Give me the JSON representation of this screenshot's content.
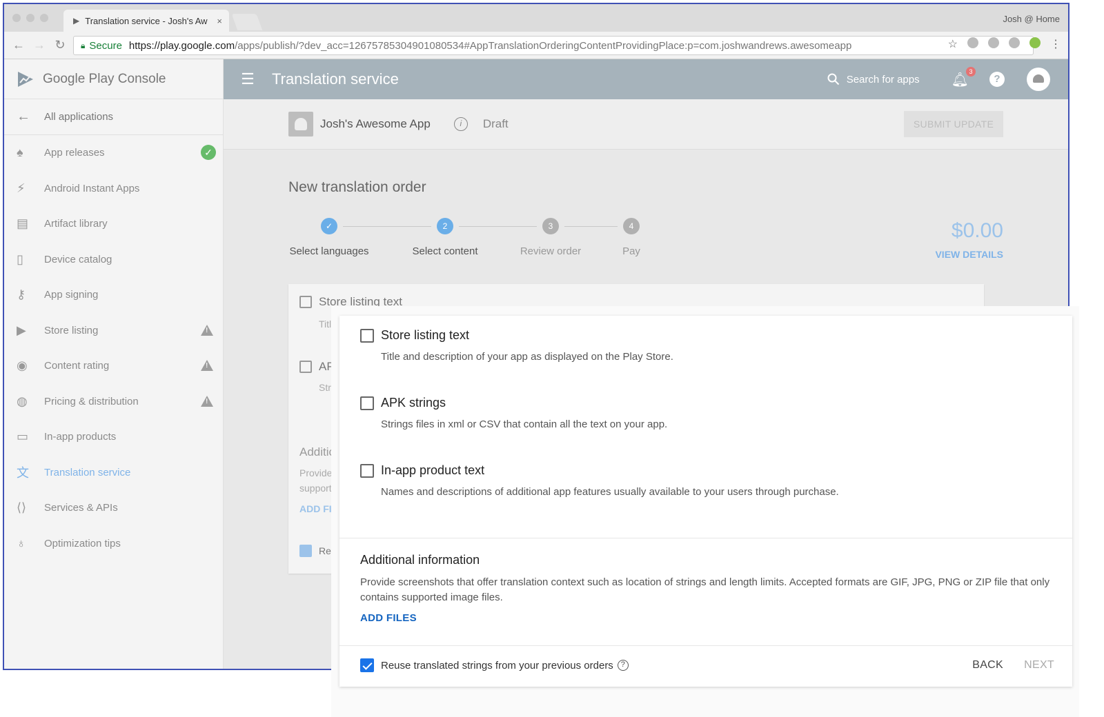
{
  "browser": {
    "tab_title": "Translation service - Josh's Aw",
    "profile": "Josh @ Home",
    "secure_label": "Secure",
    "url_host": "https://play.google.com",
    "url_path": "/apps/publish/?dev_acc=12675785304901080534#AppTranslationOrderingContentProvidingPlace:p=com.joshwandrews.awesomeapp"
  },
  "sidebar": {
    "logo_text": "Google Play Console",
    "back_label": "All applications",
    "items": [
      {
        "label": "App releases",
        "icon": "rocket-icon",
        "status": "ok"
      },
      {
        "label": "Android Instant Apps",
        "icon": "lightning-icon",
        "status": ""
      },
      {
        "label": "Artifact library",
        "icon": "library-icon",
        "status": ""
      },
      {
        "label": "Device catalog",
        "icon": "device-icon",
        "status": ""
      },
      {
        "label": "App signing",
        "icon": "key-icon",
        "status": ""
      },
      {
        "label": "Store listing",
        "icon": "store-icon",
        "status": "warning"
      },
      {
        "label": "Content rating",
        "icon": "rating-icon",
        "status": "warning"
      },
      {
        "label": "Pricing & distribution",
        "icon": "globe-icon",
        "status": "warning"
      },
      {
        "label": "In-app products",
        "icon": "card-icon",
        "status": ""
      },
      {
        "label": "Translation service",
        "icon": "translate-icon",
        "status": "",
        "active": true
      },
      {
        "label": "Services & APIs",
        "icon": "api-icon",
        "status": ""
      },
      {
        "label": "Optimization tips",
        "icon": "bulb-icon",
        "status": ""
      }
    ]
  },
  "topbar": {
    "title": "Translation service",
    "search_placeholder": "Search for apps",
    "notification_count": "3",
    "help": "?"
  },
  "appbar": {
    "app_name": "Josh's Awesome App",
    "status": "Draft",
    "submit_label": "SUBMIT UPDATE"
  },
  "order": {
    "title": "New translation order",
    "steps": [
      {
        "number": "✓",
        "label": "Select languages",
        "state": "done"
      },
      {
        "number": "2",
        "label": "Select content",
        "state": "current"
      },
      {
        "number": "3",
        "label": "Review order",
        "state": "todo"
      },
      {
        "number": "4",
        "label": "Pay",
        "state": "todo"
      }
    ],
    "price": "$0.00",
    "view_details": "VIEW DETAILS"
  },
  "background_card": {
    "row1_title": "Store listing text",
    "row1_sub": "Title",
    "row2_title": "AP",
    "row2_sub": "Strii",
    "addl_title": "Additic",
    "addl_desc1": "Provide :",
    "addl_desc2": "supporte",
    "add_files": "ADD FIL",
    "reuse": "Reu"
  },
  "dialog": {
    "options": [
      {
        "title": "Store listing text",
        "description": "Title and description of your app as displayed on the Play Store.",
        "checked": false
      },
      {
        "title": "APK strings",
        "description": "Strings files in xml or CSV that contain all the text on your app.",
        "checked": false
      },
      {
        "title": "In-app product text",
        "description": "Names and descriptions of additional app features usually available to your users through purchase.",
        "checked": false
      }
    ],
    "additional_title": "Additional information",
    "additional_desc": "Provide screenshots that offer translation context such as location of strings and length limits. Accepted formats are GIF, JPG, PNG or ZIP file that only contains supported image files.",
    "add_files": "ADD FILES",
    "reuse_label": "Reuse translated strings from your previous orders",
    "reuse_checked": true,
    "back_label": "BACK",
    "next_label": "NEXT"
  },
  "colors": {
    "accent": "#1a73e8",
    "link": "#1565c0",
    "topbar": "#a6b3bb",
    "active_nav": "#7fb3e8",
    "step_done": "#6aaee8",
    "step_todo": "#b0b0b0"
  }
}
